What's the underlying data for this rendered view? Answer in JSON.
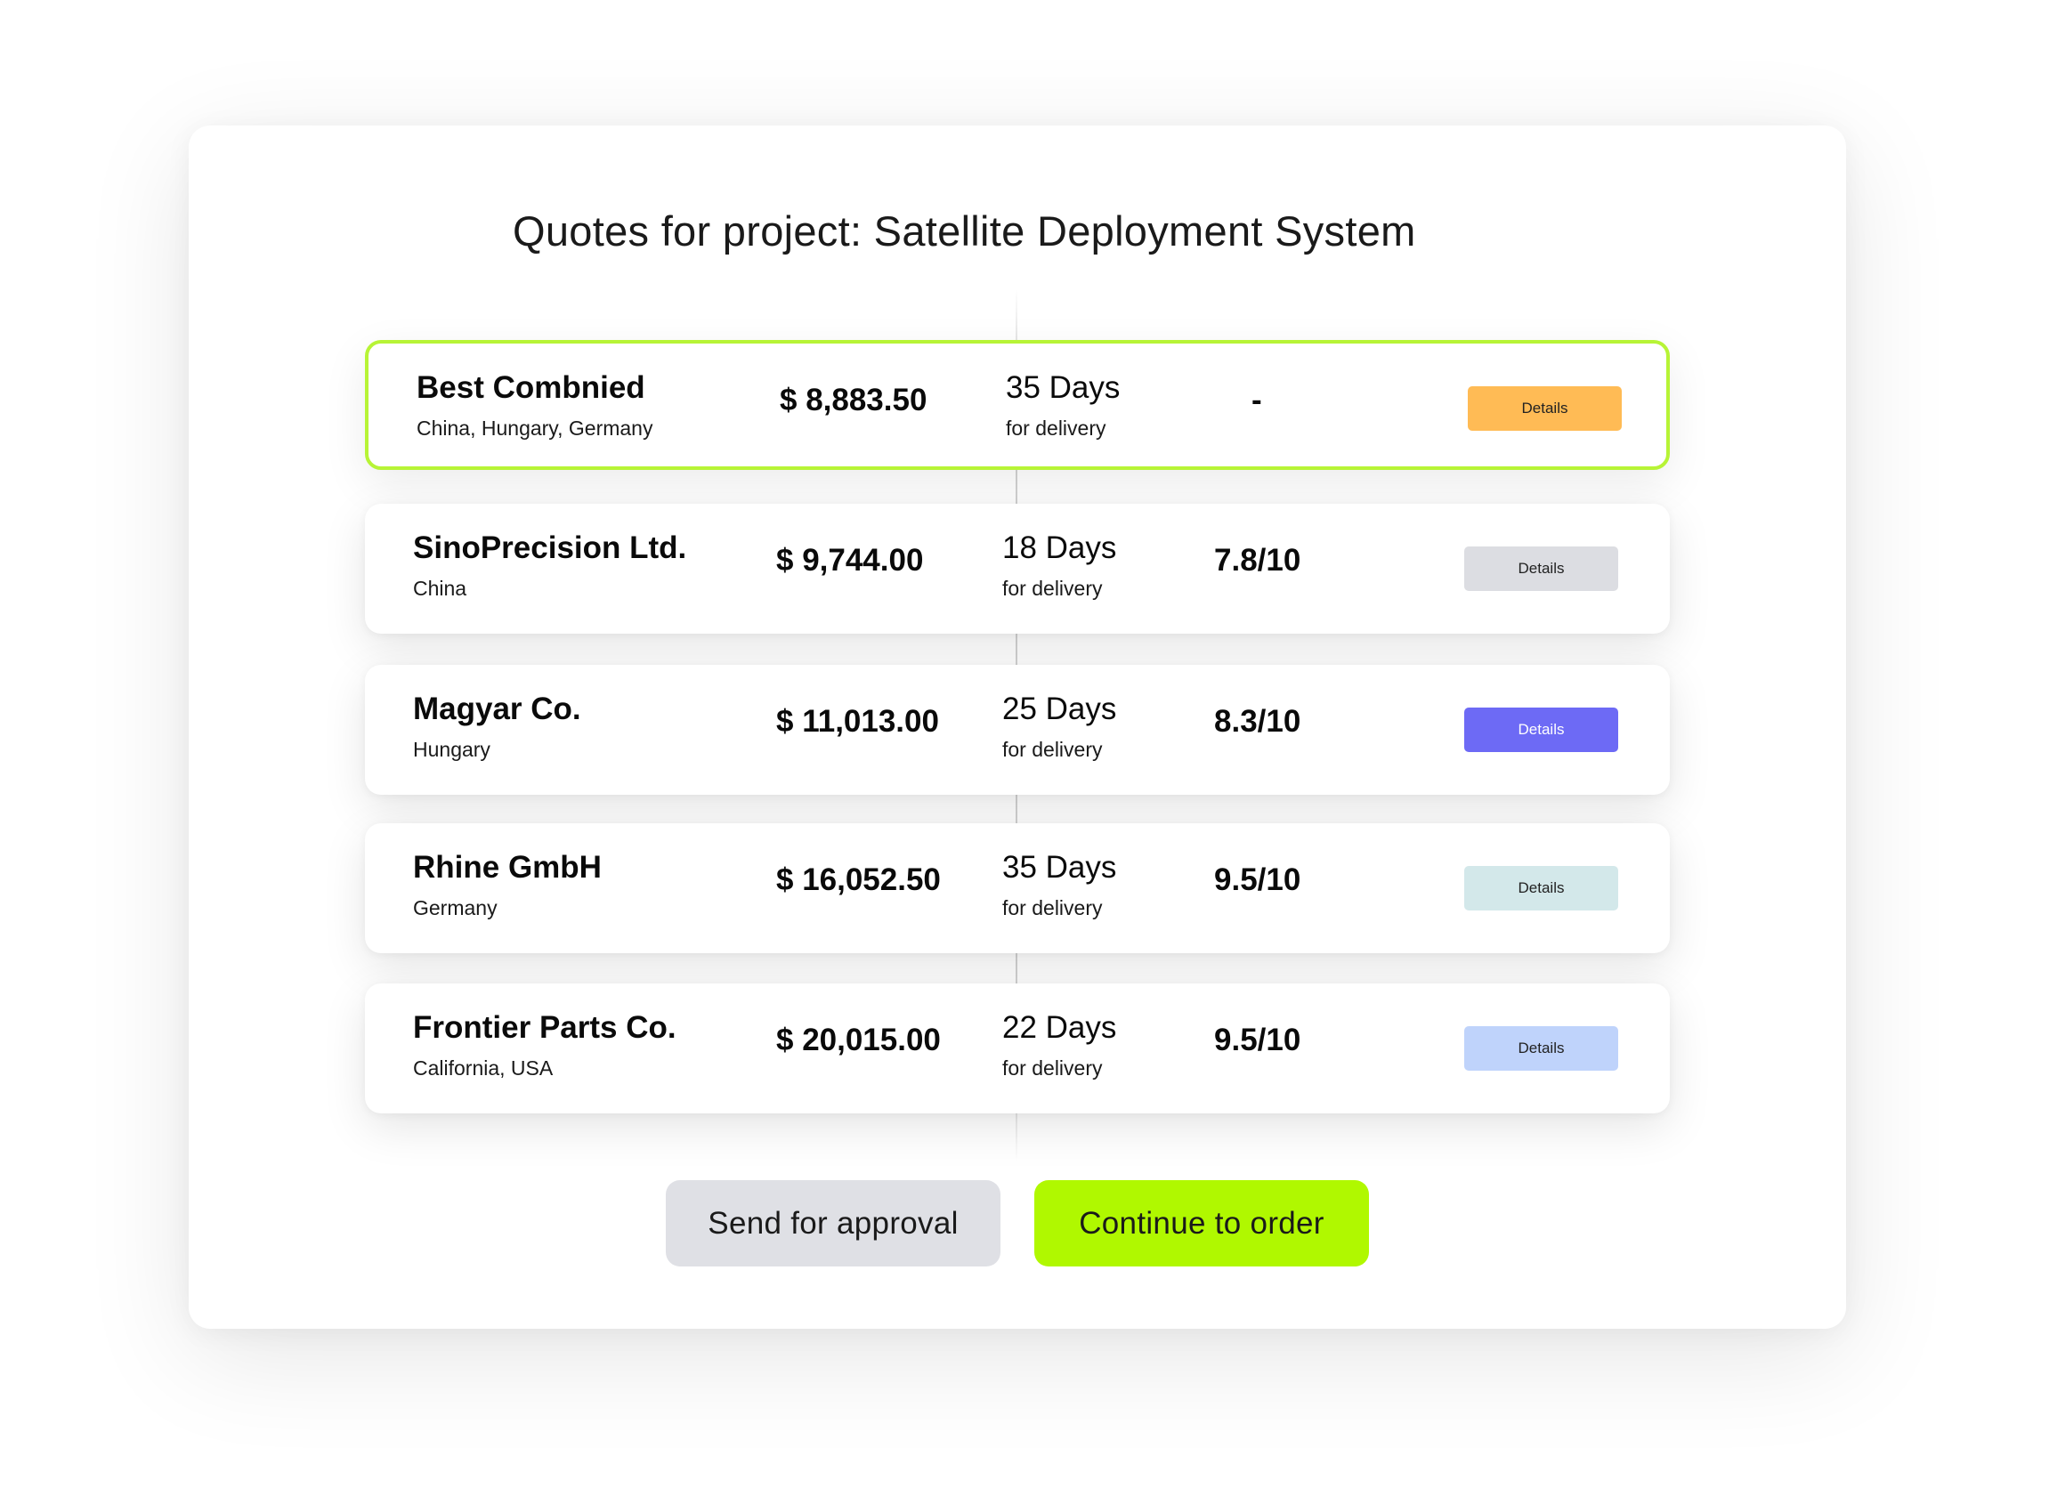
{
  "page": {
    "title": "Quotes for project: Satellite Deployment System"
  },
  "quotes": [
    {
      "name": "Best Combnied",
      "location": "China, Hungary, Germany",
      "price": "$ 8,883.50",
      "days": "35 Days",
      "days_sub": "for delivery",
      "rating": "-",
      "details_label": "Details",
      "details_color": "#ffbb55",
      "highlighted": true,
      "highlight_color": "#b7f436"
    },
    {
      "name": "SinoPrecision Ltd.",
      "location": "China",
      "price": "$ 9,744.00",
      "days": "18 Days",
      "days_sub": "for delivery",
      "rating": "7.8/10",
      "details_label": "Details",
      "details_color": "#dcdde2"
    },
    {
      "name": "Magyar Co.",
      "location": "Hungary",
      "price": "$ 11,013.00",
      "days": "25 Days",
      "days_sub": "for delivery",
      "rating": "8.3/10",
      "details_label": "Details",
      "details_color": "#6d6af5"
    },
    {
      "name": "Rhine GmbH",
      "location": "Germany",
      "price": "$ 16,052.50",
      "days": "35 Days",
      "days_sub": "for delivery",
      "rating": "9.5/10",
      "details_label": "Details",
      "details_color": "#d3e8ea"
    },
    {
      "name": "Frontier Parts Co.",
      "location": "California, USA",
      "price": "$ 20,015.00",
      "days": "22 Days",
      "days_sub": "for delivery",
      "rating": "9.5/10",
      "details_label": "Details",
      "details_color": "#bfd3fb"
    }
  ],
  "actions": {
    "send_label": "Send for approval",
    "continue_label": "Continue to order",
    "send_color": "#dfe0e5",
    "continue_color": "#b0f800"
  }
}
